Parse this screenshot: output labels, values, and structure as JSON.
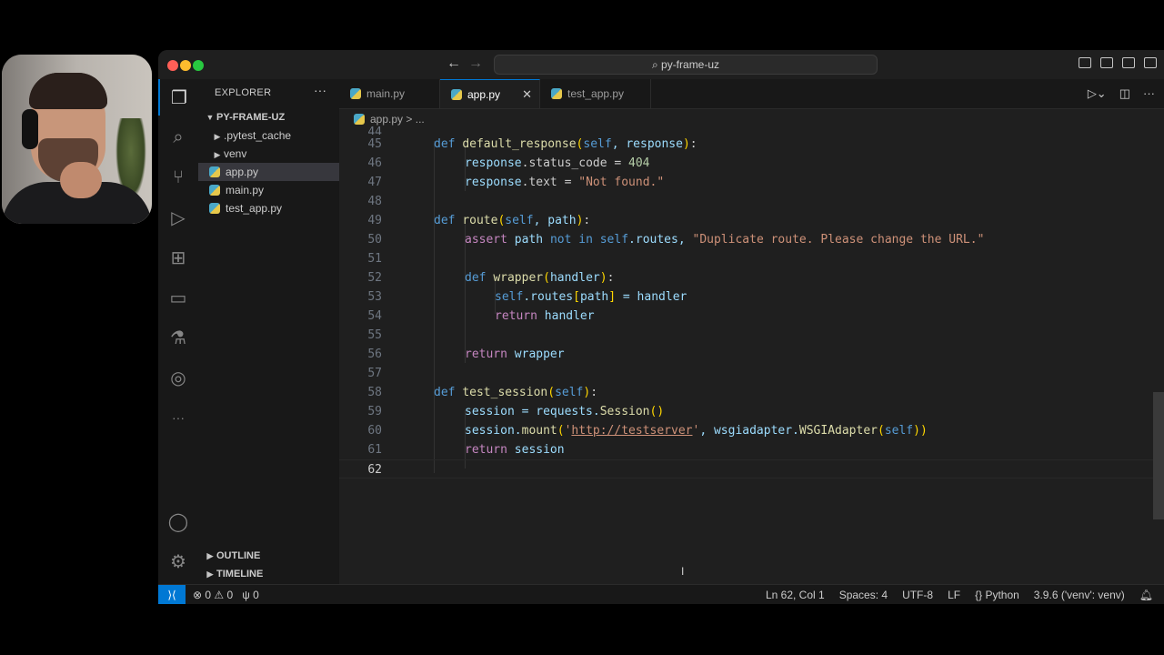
{
  "titlebar": {
    "search": "py-frame-uz",
    "back": "←",
    "forward": "→"
  },
  "activity": {
    "more": "···"
  },
  "sidebar": {
    "title": "EXPLORER",
    "more": "···",
    "folder": "PY-FRAME-UZ",
    "items": [
      {
        "label": ".pytest_cache",
        "type": "folder"
      },
      {
        "label": "venv",
        "type": "folder"
      },
      {
        "label": "app.py",
        "type": "file",
        "selected": true
      },
      {
        "label": "main.py",
        "type": "file"
      },
      {
        "label": "test_app.py",
        "type": "file"
      }
    ],
    "outline": "OUTLINE",
    "timeline": "TIMELINE"
  },
  "tabs": [
    {
      "label": "main.py",
      "active": false
    },
    {
      "label": "app.py",
      "active": true
    },
    {
      "label": "test_app.py",
      "active": false
    }
  ],
  "breadcrumb": {
    "file": "app.py",
    "sep": ">",
    "rest": "..."
  },
  "code": {
    "line_numbers": [
      "44",
      "45",
      "46",
      "47",
      "48",
      "49",
      "50",
      "51",
      "52",
      "53",
      "54",
      "55",
      "56",
      "57",
      "58",
      "59",
      "60",
      "61",
      "62"
    ],
    "line44": "",
    "l45": {
      "kw": "def",
      "fn": "default_response",
      "p1": "(",
      "self": "self",
      "args": ", response",
      "p2": ")",
      "colon": ":"
    },
    "l46": {
      "a": "response",
      "b": ".status_code = ",
      "num": "404"
    },
    "l47": {
      "a": "response",
      "b": ".text = ",
      "str": "\"Not found.\""
    },
    "l49": {
      "kw": "def",
      "fn": "route",
      "p1": "(",
      "self": "self",
      "args": ", path",
      "p2": ")",
      "colon": ":"
    },
    "l50": {
      "kw": "assert",
      "a": " path ",
      "kw2": "not in",
      "self": " self",
      "b": ".routes, ",
      "str": "\"Duplicate route. Please change the URL.\""
    },
    "l52": {
      "kw": "def",
      "fn": "wrapper",
      "p1": "(",
      "args": "handler",
      "p2": ")",
      "colon": ":"
    },
    "l53": {
      "self": "self",
      "a": ".routes",
      "p1": "[",
      "b": "path",
      "p2": "]",
      "c": " = handler"
    },
    "l54": {
      "kw": "return",
      "a": " handler"
    },
    "l56": {
      "kw": "return",
      "a": " wrapper"
    },
    "l58": {
      "kw": "def",
      "fn": "test_session",
      "p1": "(",
      "self": "self",
      "p2": ")",
      "colon": ":"
    },
    "l59": {
      "a": "session = requests.",
      "fn": "Session",
      "p": "()"
    },
    "l60": {
      "a": "session.",
      "fn": "mount",
      "p1": "(",
      "q1": "'",
      "url": "http://testserver",
      "q2": "'",
      "b": ", wsgiadapter.",
      "fn2": "WSGIAdapter",
      "p2": "(",
      "self": "self",
      "p3": "))"
    },
    "l61": {
      "kw": "return",
      "a": " session"
    }
  },
  "status": {
    "errors": "0",
    "warnings": "0",
    "ports": "0",
    "position": "Ln 62, Col 1",
    "spaces": "Spaces: 4",
    "encoding": "UTF-8",
    "eol": "LF",
    "language": "Python",
    "interpreter": "3.9.6 ('venv': venv)"
  }
}
